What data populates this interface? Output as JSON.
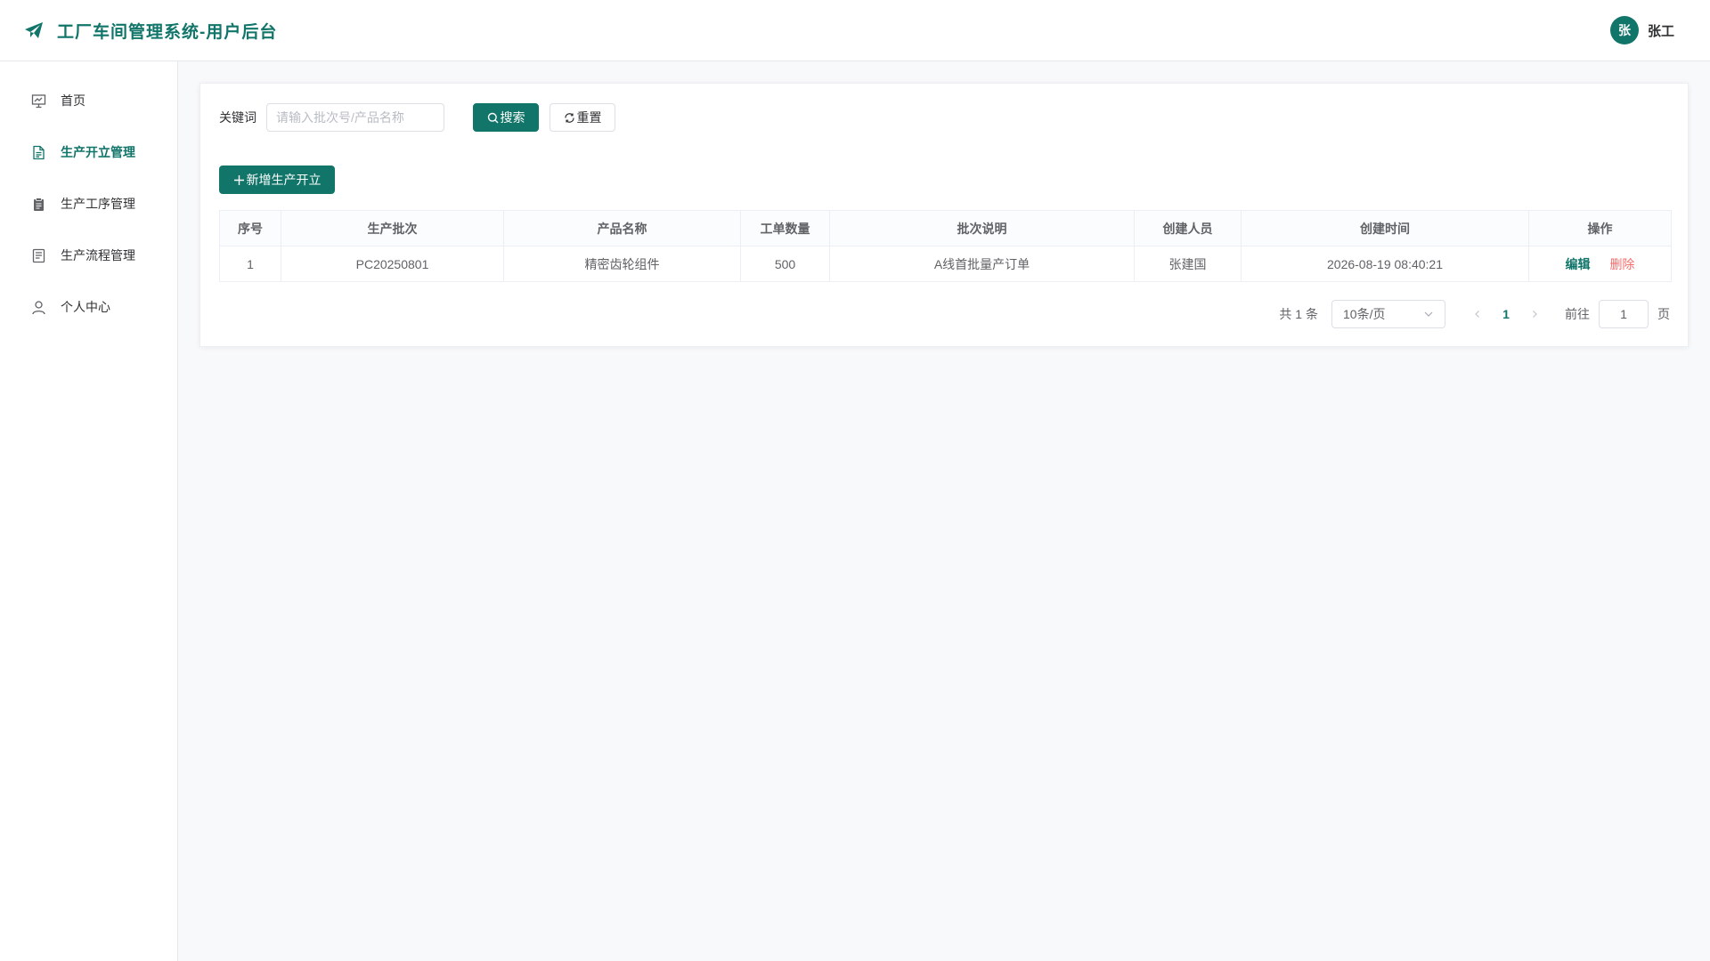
{
  "colors": {
    "brand": "#12756a",
    "danger": "#f56c6c",
    "background": "#f8f9fb"
  },
  "header": {
    "title": "工厂车间管理系统-用户后台",
    "logo_icon": "paper-plane-icon",
    "user": {
      "avatar_text": "张",
      "name": "张工"
    }
  },
  "sidebar": {
    "items": [
      {
        "label": "首页",
        "icon": "presentation-icon",
        "active": false
      },
      {
        "label": "生产开立管理",
        "icon": "document-icon",
        "active": true
      },
      {
        "label": "生产工序管理",
        "icon": "clipboard-icon",
        "active": false
      },
      {
        "label": "生产流程管理",
        "icon": "list-document-icon",
        "active": false
      },
      {
        "label": "个人中心",
        "icon": "user-icon",
        "active": false
      }
    ]
  },
  "search": {
    "label": "关键词",
    "placeholder": "请输入批次号/产品名称",
    "value": "",
    "search_label": "搜索",
    "reset_label": "重置"
  },
  "actions": {
    "add_label": "新增生产开立"
  },
  "table": {
    "columns": [
      "序号",
      "生产批次",
      "产品名称",
      "工单数量",
      "批次说明",
      "创建人员",
      "创建时间",
      "操作"
    ],
    "rows": [
      {
        "index": "1",
        "batch": "PC20250801",
        "product": "精密齿轮组件",
        "quantity": "500",
        "description": "A线首批量产订单",
        "creator": "张建国",
        "created_at": "2026-08-19 08:40:21",
        "edit_label": "编辑",
        "delete_label": "删除"
      }
    ]
  },
  "pagination": {
    "total_text": "共 1 条",
    "page_size": "10条/页",
    "current_page": "1",
    "goto_label": "前往",
    "goto_value": "1",
    "goto_suffix": "页"
  }
}
